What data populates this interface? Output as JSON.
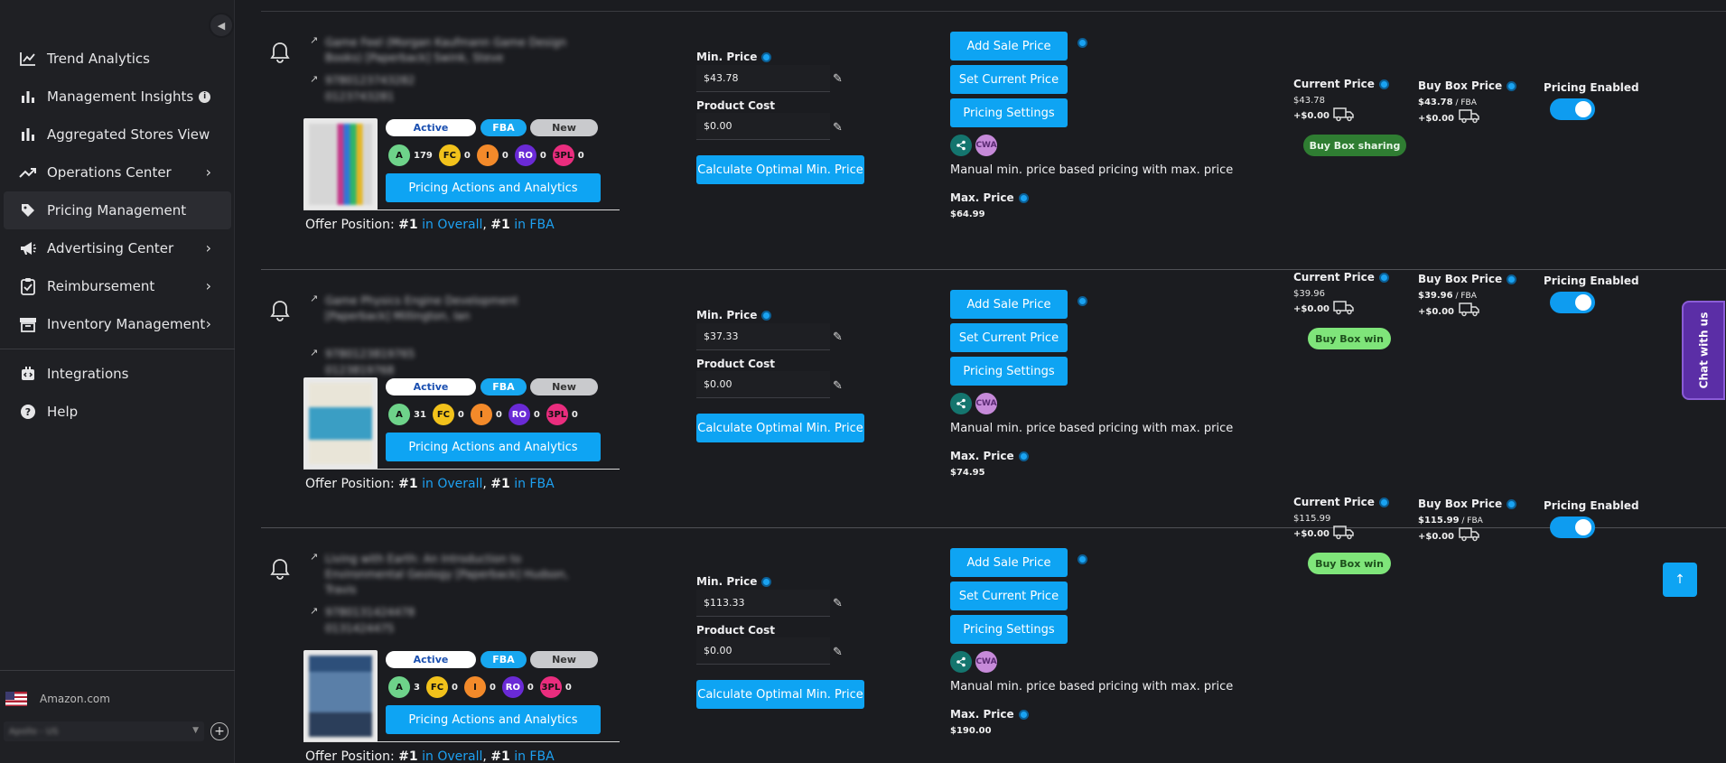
{
  "sidebar": {
    "items": [
      {
        "label": "Trend Analytics",
        "icon": "trend-chart-icon"
      },
      {
        "label": "Management Insights",
        "icon": "bar-chart-icon",
        "info": "i"
      },
      {
        "label": "Aggregated Stores View",
        "icon": "bar-chart-icon"
      },
      {
        "label": "Operations Center",
        "icon": "trending-up-icon",
        "chevron": "›"
      },
      {
        "label": "Pricing Management",
        "icon": "tag-icon"
      },
      {
        "label": "Advertising Center",
        "icon": "megaphone-icon",
        "chevron": "›"
      },
      {
        "label": "Reimbursement",
        "icon": "clipboard-check-icon",
        "chevron": "›"
      },
      {
        "label": "Inventory Management",
        "icon": "archive-icon",
        "chevron": "›"
      }
    ],
    "secondary": [
      {
        "label": "Integrations",
        "icon": "integrations-icon"
      },
      {
        "label": "Help",
        "icon": "help-icon"
      }
    ],
    "marketplace": "Amazon.com",
    "account": "Apollo - US",
    "add": "+",
    "collapse": "◀"
  },
  "products": [
    {
      "title_line1": "Game Feel (Morgan Kaufmann Game Design",
      "title_line2": "Books) [Paperback] Swink, Steve",
      "isbn": "9780123743282",
      "sku": "0123743281",
      "status": "Active",
      "channel": "FBA",
      "condition": "New",
      "fc": [
        {
          "code": "A",
          "value": "179",
          "color": "#6ed38a"
        },
        {
          "code": "FC",
          "value": "0",
          "color": "#f2c21b"
        },
        {
          "code": "I",
          "value": "0",
          "color": "#f38a2a"
        },
        {
          "code": "RO",
          "value": "0",
          "color": "#6a2ad6"
        },
        {
          "code": "3PL",
          "value": "0",
          "color": "#ea2d7e"
        }
      ],
      "min_price": "$43.78",
      "product_cost": "$0.00",
      "strategy": "Manual min. price based pricing with max. price",
      "max_price": "$64.99",
      "current_price": "$43.78",
      "current_shipping": "+$0.00",
      "buybox_status": "Buy Box sharing",
      "buybox_price": "$43.78",
      "buybox_channel": " / FBA",
      "buybox_shipping": "+$0.00",
      "offer_rank_overall": "#1",
      "offer_rank_fba": "#1"
    },
    {
      "title_line1": "Game Physics Engine Development",
      "title_line2": "[Paperback] Millington, Ian",
      "isbn": "9780123819765",
      "sku": "0123819768",
      "status": "Active",
      "channel": "FBA",
      "condition": "New",
      "fc": [
        {
          "code": "A",
          "value": "31",
          "color": "#6ed38a"
        },
        {
          "code": "FC",
          "value": "0",
          "color": "#f2c21b"
        },
        {
          "code": "I",
          "value": "0",
          "color": "#f38a2a"
        },
        {
          "code": "RO",
          "value": "0",
          "color": "#6a2ad6"
        },
        {
          "code": "3PL",
          "value": "0",
          "color": "#ea2d7e"
        }
      ],
      "min_price": "$37.33",
      "product_cost": "$0.00",
      "strategy": "Manual min. price based pricing with max. price",
      "max_price": "$74.95",
      "current_price": "$39.96",
      "current_shipping": "+$0.00",
      "buybox_status": "Buy Box win",
      "buybox_price": "$39.96",
      "buybox_channel": " / FBA",
      "buybox_shipping": "+$0.00",
      "offer_rank_overall": "#1",
      "offer_rank_fba": "#1"
    },
    {
      "title_line1": "Living with Earth: An Introduction to",
      "title_line2": "Environmental Geology [Paperback] Hudson,",
      "title_line3": "Travis",
      "isbn": "9780131424478",
      "sku": "0131424475",
      "status": "Active",
      "channel": "FBA",
      "condition": "New",
      "fc": [
        {
          "code": "A",
          "value": "3",
          "color": "#6ed38a"
        },
        {
          "code": "FC",
          "value": "0",
          "color": "#f2c21b"
        },
        {
          "code": "I",
          "value": "0",
          "color": "#f38a2a"
        },
        {
          "code": "RO",
          "value": "0",
          "color": "#6a2ad6"
        },
        {
          "code": "3PL",
          "value": "0",
          "color": "#ea2d7e"
        }
      ],
      "min_price": "$113.33",
      "product_cost": "$0.00",
      "strategy": "Manual min. price based pricing with max. price",
      "max_price": "$190.00",
      "current_price": "$115.99",
      "current_shipping": "+$0.00",
      "buybox_status": "Buy Box win",
      "buybox_price": "$115.99",
      "buybox_channel": " / FBA",
      "buybox_shipping": "+$0.00",
      "offer_rank_overall": "#1",
      "offer_rank_fba": "#1"
    }
  ],
  "labels": {
    "min_price": "Min. Price",
    "product_cost": "Product Cost",
    "calc_button": "Calculate Optimal Min. Price",
    "add_sale": "Add Sale Price",
    "set_current": "Set Current Price",
    "pricing_settings": "Pricing Settings",
    "pricing_actions": "Pricing Actions and Analytics",
    "max_price": "Max. Price",
    "current_price": "Current Price",
    "buybox_price": "Buy Box Price",
    "pricing_enabled": "Pricing Enabled",
    "offer_position": "Offer Position: ",
    "in_overall": " in Overall",
    "comma": ", ",
    "in_fba": " in FBA",
    "cwa": "CWA"
  },
  "chat": "Chat with us",
  "scroll_top": "↑",
  "colors": {
    "accent": "#0ea4f3",
    "sidebar_bg": "#1f2024",
    "page_bg": "#1b1c20"
  }
}
